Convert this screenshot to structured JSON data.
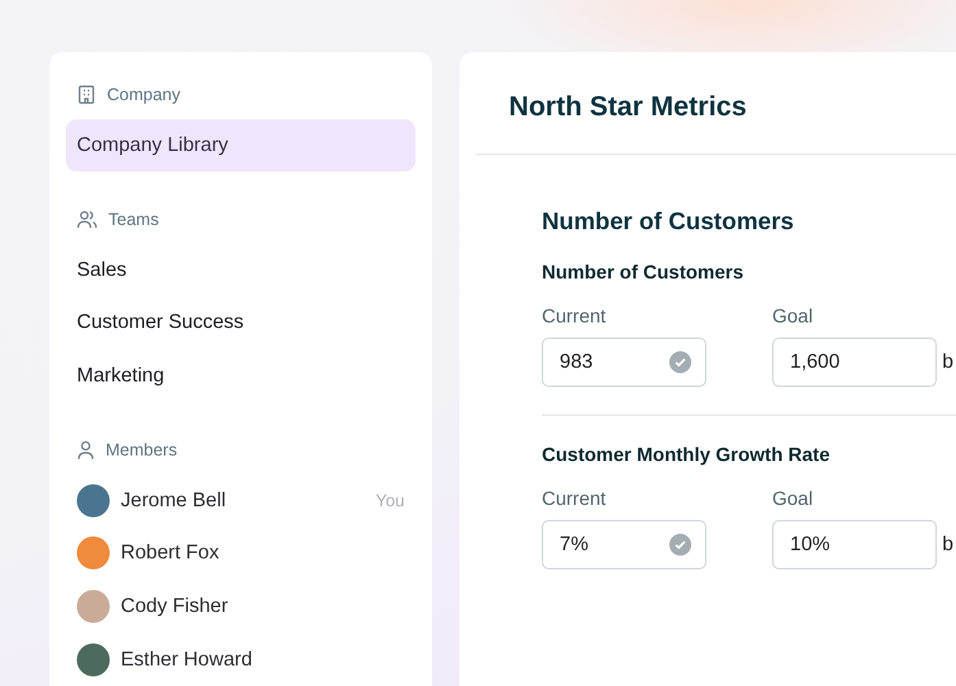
{
  "sidebar": {
    "sections": [
      {
        "kind": "company",
        "title": "Company",
        "items": [
          {
            "label": "Company Library",
            "selected": true
          }
        ]
      },
      {
        "kind": "teams",
        "title": "Teams",
        "items": [
          {
            "label": "Sales",
            "selected": false
          },
          {
            "label": "Customer Success",
            "selected": false
          },
          {
            "label": "Marketing",
            "selected": false
          }
        ]
      },
      {
        "kind": "members",
        "title": "Members",
        "members": [
          {
            "name": "Jerome Bell",
            "badge": "You",
            "color": "#4a7590"
          },
          {
            "name": "Robert Fox",
            "color": "#f08a3c"
          },
          {
            "name": "Cody Fisher",
            "color": "#c9ab97"
          },
          {
            "name": "Esther Howard",
            "color": "#4d6b5c"
          }
        ]
      }
    ]
  },
  "main": {
    "title": "North Star Metrics",
    "section_title": "Number of Customers",
    "metrics": [
      {
        "title": "Number of Customers",
        "current_label": "Current",
        "current": "983",
        "current_verified": true,
        "goal_label": "Goal",
        "goal": "1,600",
        "column_3": "b"
      },
      {
        "title": "Customer Monthly Growth Rate",
        "current_label": "Current",
        "current": "7%",
        "current_verified": true,
        "goal_label": "Goal",
        "goal": "10%",
        "column_3": "b"
      }
    ]
  }
}
